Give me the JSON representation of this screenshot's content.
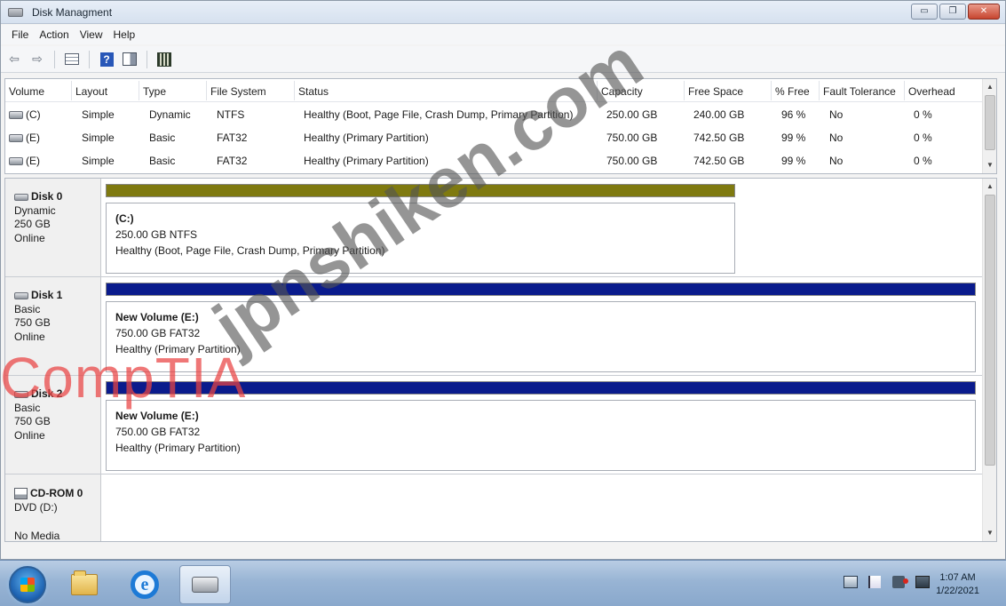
{
  "window": {
    "title": "Disk Managment",
    "min_glyph": "▭",
    "max_glyph": "❐",
    "close_glyph": "✕"
  },
  "menu": [
    "File",
    "Action",
    "View",
    "Help"
  ],
  "toolbar": {
    "back_glyph": "⇦",
    "forward_glyph": "⇨"
  },
  "volume_list": {
    "columns": [
      "Volume",
      "Layout",
      "Type",
      "File System",
      "Status",
      "Capacity",
      "Free Space",
      "% Free",
      "Fault Tolerance",
      "Overhead"
    ],
    "rows": [
      [
        "(C)",
        "Simple",
        "Dynamic",
        "NTFS",
        "Healthy (Boot, Page File, Crash Dump, Primary Partition)",
        "250.00 GB",
        "240.00 GB",
        "96 %",
        "No",
        "0 %"
      ],
      [
        "(E)",
        "Simple",
        "Basic",
        "FAT32",
        "Healthy (Primary Partition)",
        "750.00 GB",
        "742.50 GB",
        "99 %",
        "No",
        "0 %"
      ],
      [
        "(E)",
        "Simple",
        "Basic",
        "FAT32",
        "Healthy (Primary Partition)",
        "750.00 GB",
        "742.50 GB",
        "99 %",
        "No",
        "0 %"
      ]
    ]
  },
  "disks": [
    {
      "name": "Disk 0",
      "type": "Dynamic",
      "size": "250 GB",
      "state": "Online",
      "partition": {
        "name": "(C:)",
        "size_fs": "250.00 GB  NTFS",
        "status": "Healthy (Boot, Page File, Crash Dump, Primary Partition)",
        "bar_color": "#7f7a10"
      }
    },
    {
      "name": "Disk 1",
      "type": "Basic",
      "size": "750 GB",
      "state": "Online",
      "partition": {
        "name": "New Volume (E:)",
        "size_fs": "750.00 GB  FAT32",
        "status": "Healthy (Primary Partition)",
        "bar_color": "#0a1b8c"
      }
    },
    {
      "name": "Disk 2",
      "type": "Basic",
      "size": "750 GB",
      "state": "Online",
      "partition": {
        "name": "New Volume (E:)",
        "size_fs": "750.00 GB  FAT32",
        "status": "Healthy (Primary Partition)",
        "bar_color": "#0a1b8c"
      }
    }
  ],
  "cdrom": {
    "name": "CD-ROM 0",
    "drive": "DVD (D:)",
    "media": "No Media"
  },
  "taskbar": {
    "time": "1:07 AM",
    "date": "1/22/2021"
  },
  "watermarks": {
    "left": "CompTIA",
    "diagonal": "jpnshiken.com"
  }
}
